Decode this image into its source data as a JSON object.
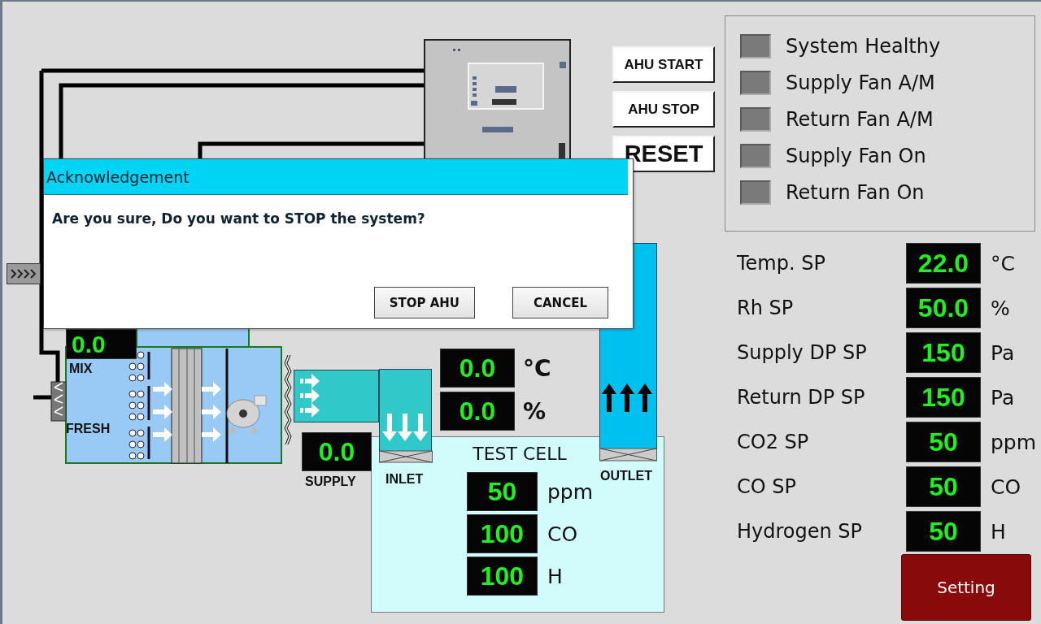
{
  "controls": [
    {
      "label": "AHU START"
    },
    {
      "label": "AHU STOP"
    },
    {
      "label": "RESET"
    }
  ],
  "status_lamps": [
    {
      "label": "System Healthy",
      "on": false
    },
    {
      "label": "Supply Fan A/M",
      "on": false
    },
    {
      "label": "Return Fan A/M",
      "on": false
    },
    {
      "label": "Supply Fan On",
      "on": false
    },
    {
      "label": "Return Fan On",
      "on": false
    }
  ],
  "setpoints": [
    {
      "label": "Temp. SP",
      "value": "22.0",
      "unit": "°C"
    },
    {
      "label": "Rh SP",
      "value": "50.0",
      "unit": "%"
    },
    {
      "label": "Supply DP SP",
      "value": "150",
      "unit": "Pa"
    },
    {
      "label": "Return DP SP",
      "value": "150",
      "unit": "Pa"
    },
    {
      "label": "CO2 SP",
      "value": "50",
      "unit": "ppm"
    },
    {
      "label": "CO SP",
      "value": "50",
      "unit": "CO"
    },
    {
      "label": "Hydrogen SP",
      "value": "50",
      "unit": "H"
    }
  ],
  "setting_button": "Setting",
  "process": {
    "mix_value": "0.0",
    "mix_label": "MIX",
    "fresh_label": "FRESH",
    "supply_value": "0.0",
    "supply_label": "SUPPLY",
    "inlet_label": "INLET",
    "outlet_label": "OUTLET",
    "room_readings": [
      {
        "value": "0.0",
        "unit": "°C"
      },
      {
        "value": "0.0",
        "unit": "%"
      }
    ],
    "test_cell": {
      "title": "TEST CELL",
      "readings": [
        {
          "value": "50",
          "unit": "ppm"
        },
        {
          "value": "100",
          "unit": "CO"
        },
        {
          "value": "100",
          "unit": "H"
        }
      ]
    }
  },
  "dialog": {
    "title": "Acknowledgement",
    "message": "Are you sure, Do you want to STOP the system?",
    "buttons": [
      "STOP AHU",
      "CANCEL"
    ]
  }
}
